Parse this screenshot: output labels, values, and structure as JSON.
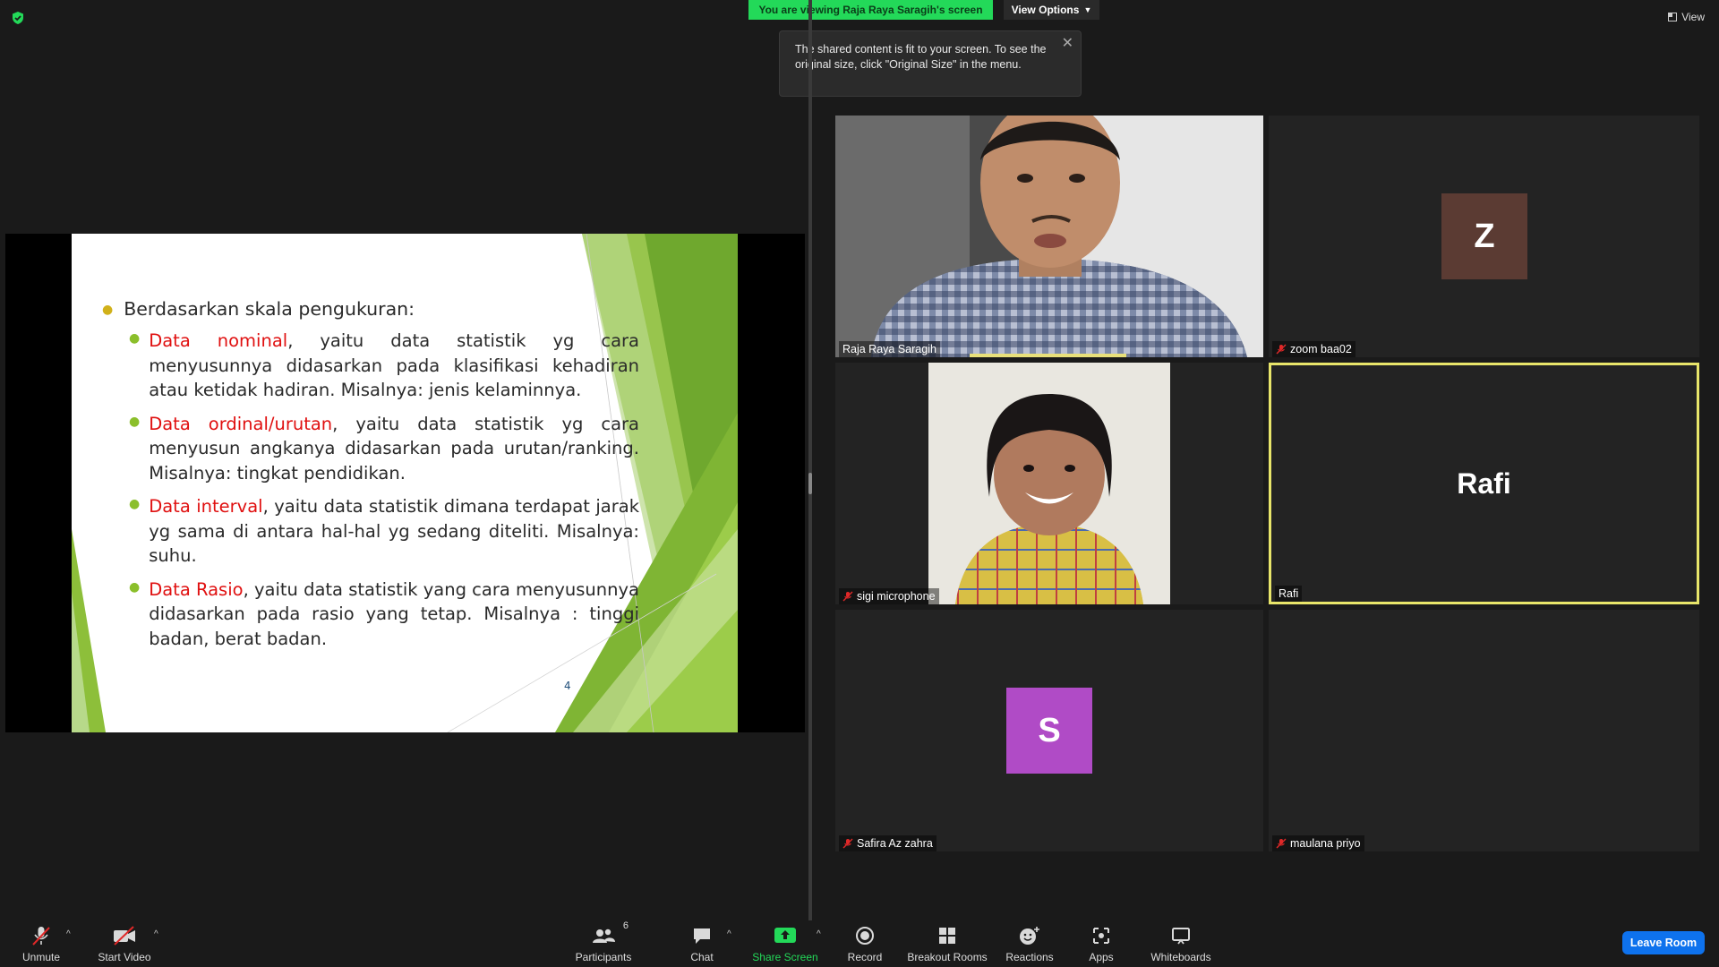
{
  "top": {
    "viewing_banner": "You are viewing Raja Raya Saragih's screen",
    "view_options": "View Options",
    "view_button": "View"
  },
  "tooltip": {
    "text": "The shared content is fit to your screen. To see the original size, click \"Original Size\" in the menu."
  },
  "slide": {
    "heading": "Berdasarkan skala pengukuran:",
    "items": [
      {
        "term": "Data nominal",
        "text": ", yaitu data statistik yg cara menyusunnya didasarkan pada klasifikasi kehadiran atau ketidak hadiran. Misalnya: jenis kelaminnya."
      },
      {
        "term": "Data ordinal/urutan",
        "text": ", yaitu data statistik yg cara menyusun angkanya didasarkan pada urutan/ranking. Misalnya: tingkat pendidikan."
      },
      {
        "term": "Data interval",
        "text": ", yaitu data statistik dimana terdapat jarak yg sama di antara hal-hal yg sedang diteliti. Misalnya: suhu."
      },
      {
        "term": "Data Rasio",
        "text": ", yaitu data statistik yang cara menyusunnya didasarkan pada rasio yang tetap. Misalnya : tinggi badan, berat badan."
      }
    ],
    "page_number": "4"
  },
  "participants": [
    {
      "name": "Raja Raya Saragih",
      "muted": false
    },
    {
      "name": "zoom baa02",
      "muted": true,
      "initial": "Z",
      "color": "#5b3b33"
    },
    {
      "name": "sigi microphone",
      "muted": true
    },
    {
      "name": "Rafi",
      "muted": false,
      "display": "Rafi"
    },
    {
      "name": "Safira Az zahra",
      "muted": true,
      "initial": "S",
      "color": "#b04bc6"
    },
    {
      "name": "maulana priyo",
      "muted": true
    }
  ],
  "toolbar": {
    "unmute": "Unmute",
    "start_video": "Start Video",
    "participants": "Participants",
    "participants_count": "6",
    "chat": "Chat",
    "share_screen": "Share Screen",
    "record": "Record",
    "breakout_rooms": "Breakout Rooms",
    "reactions": "Reactions",
    "apps": "Apps",
    "whiteboards": "Whiteboards",
    "leave": "Leave Room"
  }
}
